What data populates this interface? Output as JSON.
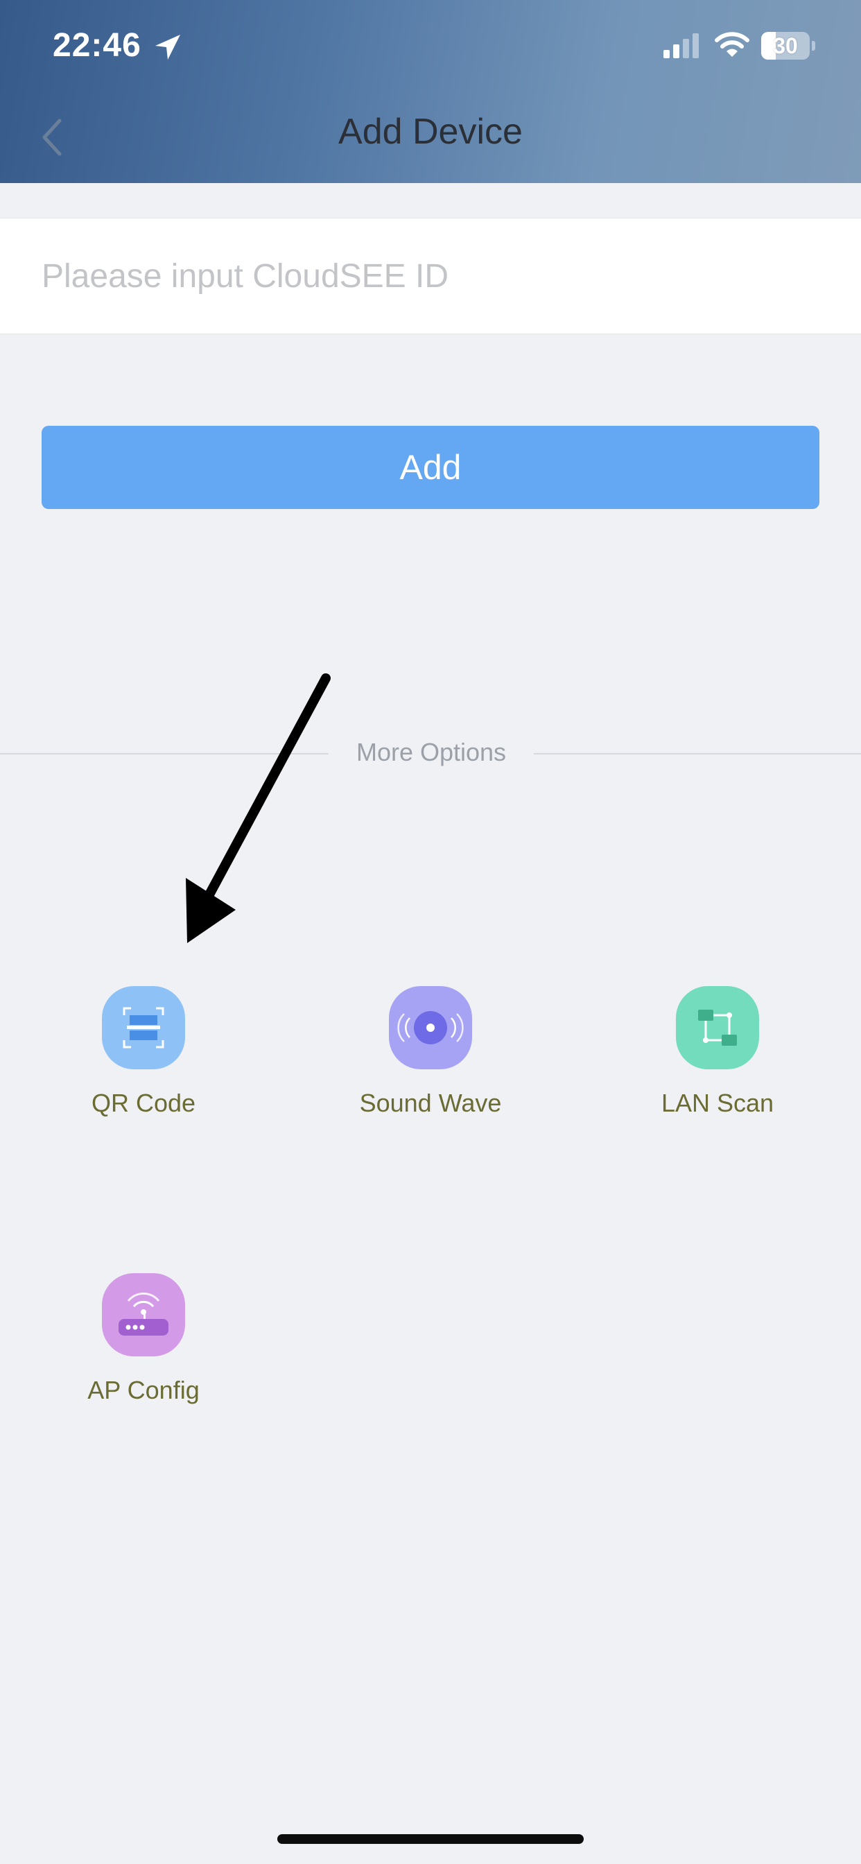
{
  "status_bar": {
    "time": "22:46",
    "battery": "30",
    "battery_level": 0.3,
    "icons": [
      "location-arrow-icon",
      "cellular-signal-icon",
      "wifi-icon",
      "battery-icon"
    ]
  },
  "nav": {
    "title": "Add Device",
    "back_icon": "chevron-left-icon"
  },
  "input": {
    "placeholder": "Plaease input CloudSEE ID",
    "value": ""
  },
  "add_button": {
    "label": "Add",
    "color": "#64a7f2"
  },
  "more_options": {
    "label": "More Options",
    "items": [
      {
        "label": "QR Code",
        "icon": "qr-scan-icon",
        "color": "#8ec2f6"
      },
      {
        "label": "Sound Wave",
        "icon": "sound-wave-icon",
        "color": "#a7a3f4"
      },
      {
        "label": "LAN Scan",
        "icon": "lan-scan-icon",
        "color": "#73dcbd"
      },
      {
        "label": "AP Config",
        "icon": "router-icon",
        "color": "#d39ae8"
      }
    ]
  },
  "annotation": {
    "icon": "arrow-annotation-icon"
  }
}
